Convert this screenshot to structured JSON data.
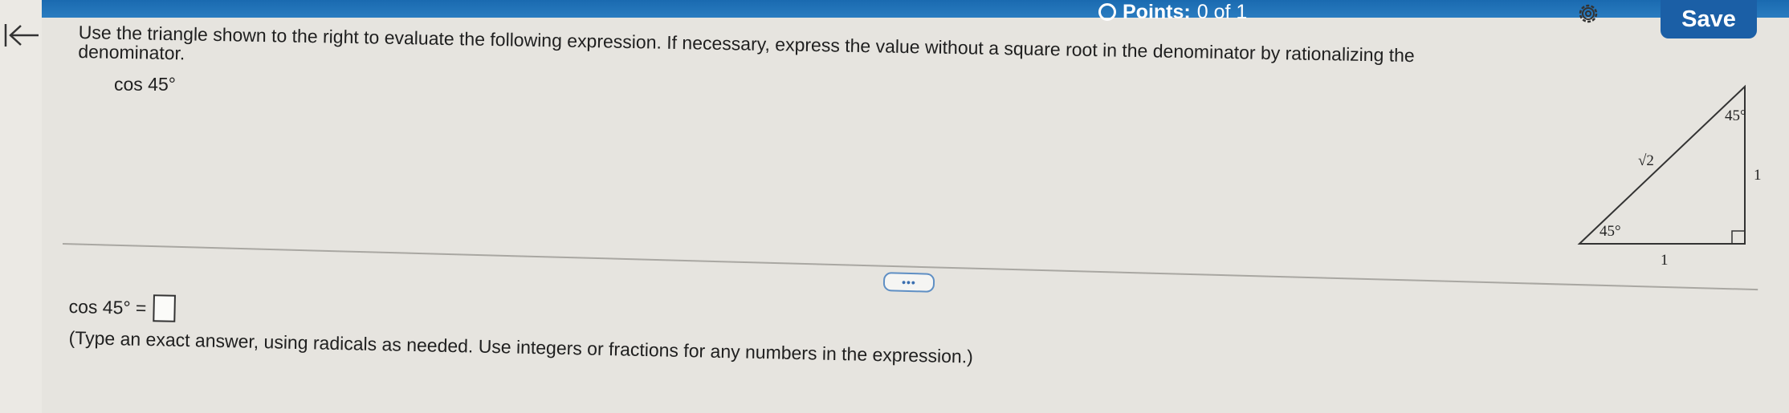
{
  "header": {
    "points_label": "Points:",
    "points_value": "0 of 1",
    "save_label": "Save"
  },
  "question": {
    "instruction_line1": "Use the triangle shown to the right to evaluate the following expression. If necessary, express the value without a square root in the denominator by rationalizing the",
    "instruction_line2": "denominator.",
    "expression": "cos 45°"
  },
  "triangle": {
    "hypotenuse_label": "√2",
    "bottom_angle_label": "45°",
    "top_angle_label": "45°",
    "side_label": "1",
    "base_label": "1"
  },
  "more_button_label": "•••",
  "answer": {
    "prefix": "cos 45° =",
    "value": "",
    "hint": "(Type an exact answer, using radicals as needed. Use integers or fractions for any numbers in the expression.)"
  },
  "icons": {
    "back": "back-to-start-icon",
    "points": "circle-icon",
    "settings": "gear-icon"
  },
  "colors": {
    "header_blue": "#1a6ab0",
    "save_button": "#1b5fa6",
    "page_background": "#e6e4df"
  }
}
